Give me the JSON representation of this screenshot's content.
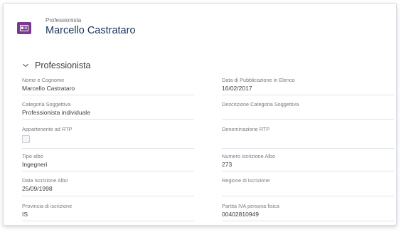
{
  "header": {
    "object_label": "Professionista",
    "record_title": "Marcello Castrataro",
    "icon": "contact-card-icon",
    "icon_color": "#7b3a8f"
  },
  "section": {
    "title": "Professionista",
    "expanded": true
  },
  "fields": {
    "nome_cognome": {
      "label": "Nome e Cognome",
      "value": "Marcello Castrataro"
    },
    "data_pubblicazione": {
      "label": "Data di Pubblicazione in Elenco",
      "value": "16/02/2017"
    },
    "categoria_soggettiva": {
      "label": "Categoria Soggettiva",
      "value": "Professionista individuale"
    },
    "descrizione_categoria": {
      "label": "Descrizione Categoria Soggettiva",
      "value": ""
    },
    "appartenente_rtp": {
      "label": "Appartenente ad RTP",
      "checked": false
    },
    "denominazione_rtp": {
      "label": "Denominazione RTP",
      "value": ""
    },
    "tipo_albo": {
      "label": "Tipo albo",
      "value": "Ingegneri"
    },
    "numero_iscrizione": {
      "label": "Numero Iscrizione Albo",
      "value": "273"
    },
    "data_iscrizione": {
      "label": "Data Iscrizione Albo",
      "value": "25/09/1998"
    },
    "regione_iscrizione": {
      "label": "Regione di iscrizione",
      "value": ""
    },
    "provincia_iscrizione": {
      "label": "Provincia di iscrizione",
      "value": "IS"
    },
    "partita_iva": {
      "label": "Partita IVA persona fisica",
      "value": "00402810949"
    }
  }
}
